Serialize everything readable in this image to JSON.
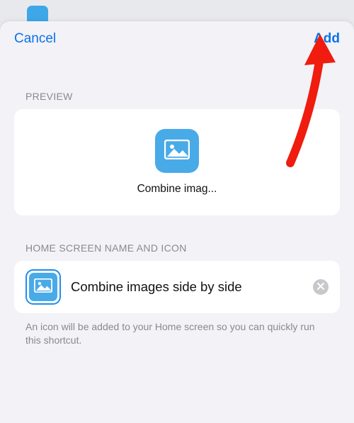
{
  "nav": {
    "cancel": "Cancel",
    "add": "Add"
  },
  "sections": {
    "preview": {
      "header": "PREVIEW",
      "icon": "photo-icon",
      "label": "Combine imag..."
    },
    "nameIcon": {
      "header": "HOME SCREEN NAME AND ICON",
      "thumbIcon": "photo-icon",
      "value": "Combine images side by side",
      "clearIcon": "x-icon"
    }
  },
  "footnote": "An icon will be added to your Home screen so you can quickly run this shortcut.",
  "colors": {
    "accent": "#0b72e7",
    "iconBg": "#49aae8",
    "sheetBg": "#f2f2f7"
  },
  "annotation": {
    "arrowColor": "#ef1c0f"
  }
}
